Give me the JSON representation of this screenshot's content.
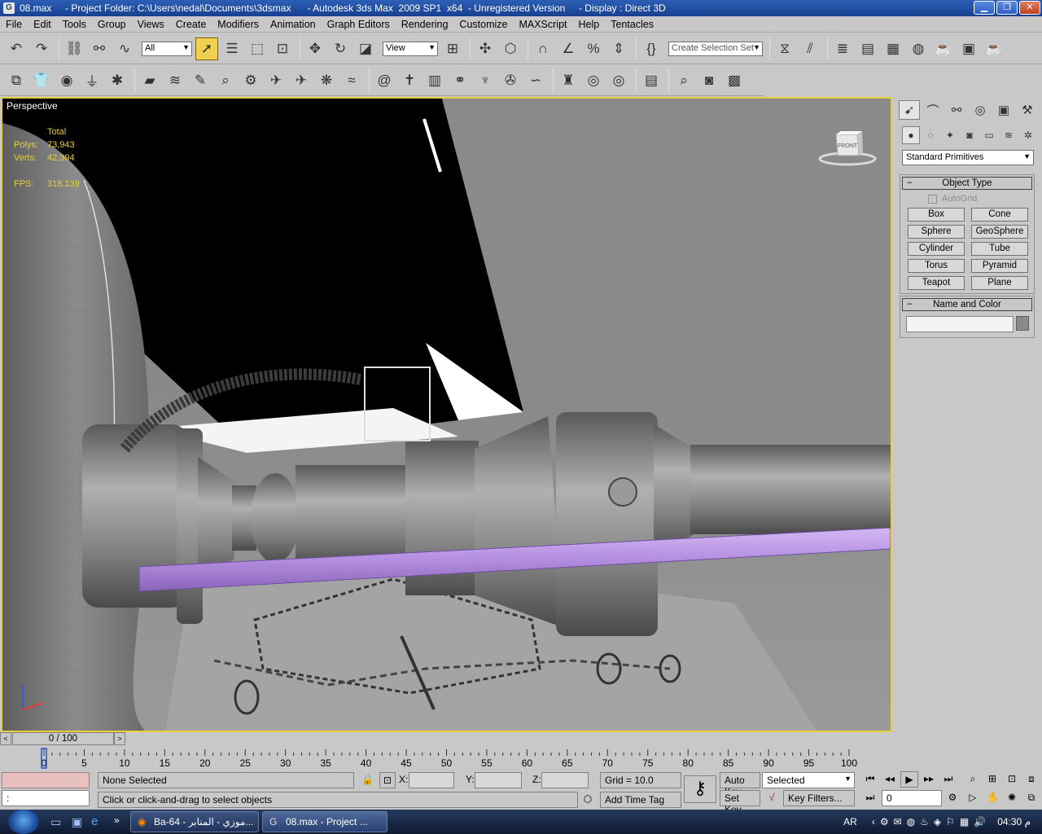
{
  "window": {
    "title": "08.max     - Project Folder: C:\\Users\\nedal\\Documents\\3dsmax      - Autodesk 3ds Max  2009 SP1  x64  - Unregistered Version     - Display : Direct 3D",
    "min_label": "▁",
    "max_label": "❐",
    "close_label": "✕"
  },
  "menu": [
    "File",
    "Edit",
    "Tools",
    "Group",
    "Views",
    "Create",
    "Modifiers",
    "Animation",
    "Graph Editors",
    "Rendering",
    "Customize",
    "MAXScript",
    "Help",
    "Tentacles"
  ],
  "toolbar1": {
    "filter_value": "All",
    "refcoord_value": "View",
    "selection_set_placeholder": "Create Selection Set"
  },
  "viewport": {
    "label": "Perspective",
    "stats": {
      "header": "Total",
      "polys_label": "Polys:",
      "polys": "73,943",
      "verts_label": "Verts:",
      "verts": "42,394",
      "fps_label": "FPS:",
      "fps": "318.139"
    },
    "viewcube_label": "FRONT"
  },
  "command_panel": {
    "category": "Standard Primitives",
    "object_type_title": "Object Type",
    "autogrid_label": "AutoGrid",
    "buttons": [
      "Box",
      "Cone",
      "Sphere",
      "GeoSphere",
      "Cylinder",
      "Tube",
      "Torus",
      "Pyramid",
      "Teapot",
      "Plane"
    ],
    "name_color_title": "Name and Color",
    "name_value": "",
    "object_color": "#8a8a8a"
  },
  "timeline": {
    "frame_display": "0 / 100",
    "ticks": [
      "0",
      "5",
      "10",
      "15",
      "20",
      "25",
      "30",
      "35",
      "40",
      "45",
      "50",
      "55",
      "60",
      "65",
      "70",
      "75",
      "80",
      "85",
      "90",
      "95",
      "100"
    ]
  },
  "status": {
    "selection": "None Selected",
    "prompt": "Click or click-and-drag to select objects",
    "x_label": "X:",
    "y_label": "Y:",
    "z_label": "Z:",
    "x_value": "",
    "y_value": "",
    "z_value": "",
    "grid": "Grid = 10.0",
    "add_time_tag": "Add Time Tag",
    "auto_key": "Auto Key",
    "set_key": "Set Key",
    "key_mode": "Selected",
    "key_filters": "Key Filters...",
    "current_frame": "0",
    "script_prompt": ":"
  },
  "taskbar": {
    "tasks": [
      "Ba-64 - موزي - المنابر...",
      "08.max     - Project ..."
    ],
    "language": "AR",
    "clock": "04:30 م"
  },
  "colors": {
    "viewport_border": "#e8d03a",
    "stats_text": "#e8d03a",
    "selected_rod": "#b48ee0",
    "title_bar": "#2d5fb6"
  }
}
